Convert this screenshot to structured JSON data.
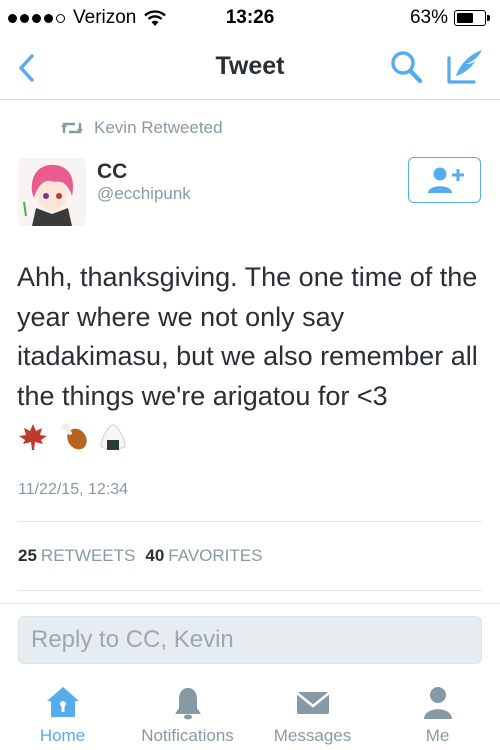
{
  "status_bar": {
    "carrier": "Verizon",
    "time": "13:26",
    "battery_percent": "63%",
    "battery_level": 0.63,
    "signal_bars": 4
  },
  "nav": {
    "title": "Tweet",
    "back_icon": "chevron-left-icon",
    "search_icon": "search-icon",
    "compose_icon": "compose-icon"
  },
  "tweet": {
    "retweet_context": "Kevin Retweeted",
    "author_name": "CC",
    "author_handle": "@ecchipunk",
    "text": "Ahh, thanksgiving. The one time of the year where we not only say itadakimasu, but we also remember all the things we're arigatou for <3",
    "emojis": [
      "maple-leaf-icon",
      "poultry-leg-icon",
      "rice-ball-icon"
    ],
    "timestamp": "11/22/15, 12:34",
    "retweets_count": "25",
    "retweets_label": "RETWEETS",
    "favorites_count": "40",
    "favorites_label": "FAVORITES"
  },
  "reply": {
    "placeholder": "Reply to CC, Kevin"
  },
  "tab_bar": {
    "tabs": [
      {
        "label": "Home",
        "icon": "home-icon",
        "active": true
      },
      {
        "label": "Notifications",
        "icon": "bell-icon",
        "active": false
      },
      {
        "label": "Messages",
        "icon": "envelope-icon",
        "active": false
      },
      {
        "label": "Me",
        "icon": "person-icon",
        "active": false
      }
    ]
  },
  "colors": {
    "accent": "#55acee",
    "secondary_text": "#8899a6",
    "primary_text": "#292f33"
  }
}
